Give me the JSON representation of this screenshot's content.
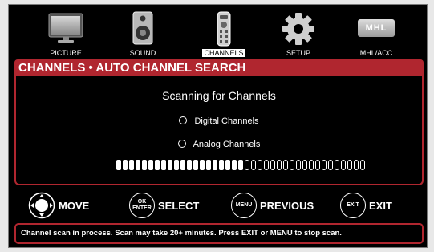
{
  "top_menu": [
    {
      "label": "PICTURE",
      "icon": "tv-icon",
      "active": false
    },
    {
      "label": "SOUND",
      "icon": "speaker-icon",
      "active": false
    },
    {
      "label": "CHANNELS",
      "icon": "remote-icon",
      "active": true
    },
    {
      "label": "SETUP",
      "icon": "gear-icon",
      "active": false
    },
    {
      "label": "MHL/ACC",
      "icon": "mhl-icon",
      "active": false
    }
  ],
  "mhl_logo_text": "MHL",
  "title": "CHANNELS • AUTO CHANNEL SEARCH",
  "scan_title": "Scanning for Channels",
  "options": {
    "digital": "Digital Channels",
    "analog": "Analog Channels"
  },
  "progress": {
    "filled_blocks": 20,
    "total_blocks": 39,
    "fraction": 0.513
  },
  "controls": {
    "move": "MOVE",
    "select_circle_top": "OK",
    "select_circle_bottom": "ENTER",
    "select": "SELECT",
    "menu_circle": "MENU",
    "previous": "PREVIOUS",
    "exit_circle": "EXIT",
    "exit": "EXIT"
  },
  "status_text": "Channel scan in process. Scan may take 20+ minutes. Press EXIT or MENU to stop scan.",
  "colors": {
    "accent": "#b0262f",
    "background": "#000000",
    "text": "#ffffff"
  }
}
